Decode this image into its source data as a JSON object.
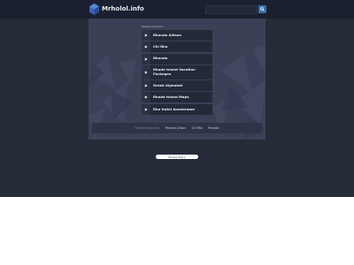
{
  "header": {
    "site_name": "Mrholol.info",
    "search_icon": "search-icon",
    "logo_icon": "cube-icon"
  },
  "main": {
    "related_label": "Related Searches",
    "results": [
      {
        "label": "Rhonda Allison"
      },
      {
        "label": "Chi Rho"
      },
      {
        "label": "Rhonda"
      },
      {
        "label": "Rhode Island Vacation Packages"
      },
      {
        "label": "Greek Alphabet"
      },
      {
        "label": "Rhode Island Maps"
      },
      {
        "label": "Rho Hotel Amsterdam"
      }
    ]
  },
  "footer": {
    "links": [
      "Related Searches",
      "Rhonda Allison",
      "Chi Rho",
      "Rhonda"
    ],
    "privacy": "Privacy Policy"
  },
  "colors": {
    "background": "#262b38",
    "header": "#1b2030",
    "panel": "#3a4157",
    "item": "#242938",
    "accent": "#3c6fa8"
  }
}
